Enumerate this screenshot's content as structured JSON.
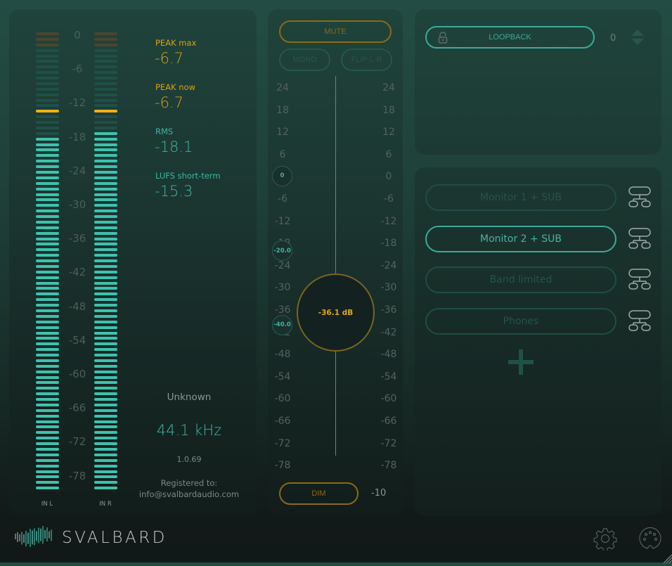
{
  "meters": {
    "scale": [
      "0",
      "-6",
      "-12",
      "-18",
      "-24",
      "-30",
      "-36",
      "-42",
      "-48",
      "-54",
      "-60",
      "-66",
      "-72",
      "-78"
    ],
    "segment_count": 83,
    "channels": [
      {
        "name": "IN L",
        "peak_hold_segment": 14,
        "lit_from_segment": 19
      },
      {
        "name": "IN R",
        "peak_hold_segment": 14,
        "lit_from_segment": 18
      }
    ],
    "colors": {
      "lit": "#3ec2ad",
      "unlit": "#1f5048",
      "top_unlit": "#4a4530",
      "peak": "#f0b20f"
    }
  },
  "stats": {
    "peak_max_label": "PEAK max",
    "peak_max_value": "-6.7",
    "peak_now_label": "PEAK now",
    "peak_now_value": "-6.7",
    "rms_label": "RMS",
    "rms_value": "-18.1",
    "lufs_label": "LUFS short-term",
    "lufs_value": "-15.3"
  },
  "info": {
    "device": "Unknown",
    "sample_rate": "44.1 kHz",
    "version": "1.0.69",
    "registered_label": "Registered to:",
    "registered_email": "info@svalbardaudio.com"
  },
  "fader": {
    "mute_label": "MUTE",
    "mono_label": "MONO",
    "flip_label": "FLIP L-R",
    "ticks": [
      "24",
      "18",
      "12",
      "6",
      "0",
      "-6",
      "-12",
      "-18",
      "-24",
      "-30",
      "-36",
      "-42",
      "-48",
      "-54",
      "-60",
      "-66",
      "-72",
      "-78"
    ],
    "presets": [
      "0",
      "-20.0",
      "-40.0"
    ],
    "value_label": "-36.1 dB",
    "value_db": -36.1,
    "dim_label": "DIM",
    "dim_value": "-10"
  },
  "loopback": {
    "label": "LOOPBACK",
    "value": "0"
  },
  "outputs": [
    {
      "label": "Monitor 1 + SUB",
      "active": false
    },
    {
      "label": "Monitor 2 + SUB",
      "active": true
    },
    {
      "label": "Band limited",
      "active": false
    },
    {
      "label": "Phones",
      "active": false
    }
  ],
  "brand": {
    "name": "SVALBARD"
  }
}
